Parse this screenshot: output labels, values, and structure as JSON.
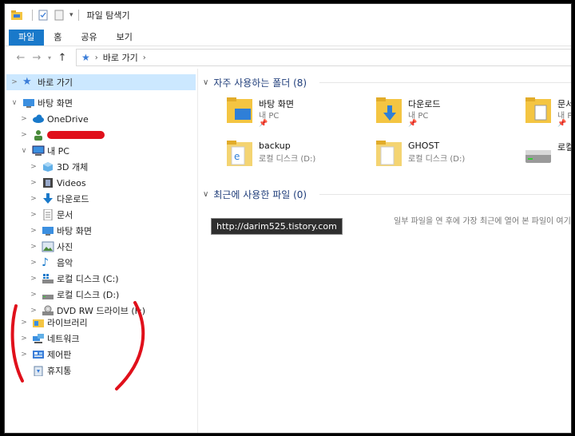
{
  "window": {
    "title": "파일 탐색기"
  },
  "ribbon": {
    "tabs": [
      "파일",
      "홈",
      "공유",
      "보기"
    ]
  },
  "address": {
    "crumb": "바로 가기"
  },
  "sidebar": {
    "quick_access": "바로 가기",
    "desktop": "바탕 화면",
    "onedrive": "OneDrive",
    "mypc": "내 PC",
    "pc_children": [
      "3D 개체",
      "Videos",
      "다운로드",
      "문서",
      "바탕 화면",
      "사진",
      "음악",
      "로컬 디스크 (C:)",
      "로컬 디스크 (D:)",
      "DVD RW 드라이브 (F:)"
    ],
    "library": "라이브러리",
    "network": "네트워크",
    "control_panel": "제어판",
    "recycle_bin": "휴지통"
  },
  "main": {
    "frequent_header": "자주 사용하는 폴더 (8)",
    "recent_header": "최근에 사용한 파일 (0)",
    "folders": [
      {
        "name": "바탕 화면",
        "sub": "내 PC"
      },
      {
        "name": "다운로드",
        "sub": "내 PC"
      },
      {
        "name": "문서",
        "sub": "내 PC"
      },
      {
        "name": "backup",
        "sub": "로컬 디스크 (D:)"
      },
      {
        "name": "GHOST",
        "sub": "로컬 디스크 (D:)"
      },
      {
        "name": "로컬",
        "sub": ""
      }
    ],
    "empty_message": "일부 파일을 연 후에 가장 최근에 열어 본 파일이 여기에 표시됩니다."
  },
  "watermark": "http://darim525.tistory.com",
  "colors": {
    "accent": "#1979ca",
    "selection": "#cce8ff",
    "annotation": "#e0101b"
  }
}
